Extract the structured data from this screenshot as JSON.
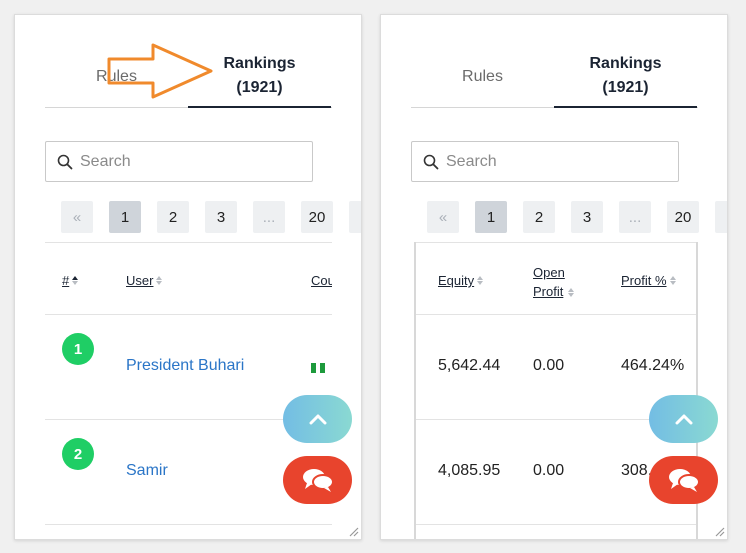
{
  "tabs": {
    "rules": "Rules",
    "rankings_line1": "Rankings",
    "rankings_line2": "(1921)"
  },
  "search": {
    "placeholder": "Search"
  },
  "pagination": {
    "prev": "«",
    "pages": [
      "1",
      "2",
      "3",
      "...",
      "20"
    ],
    "current": "1"
  },
  "table": {
    "columns": {
      "rank": "#",
      "user": "User",
      "country_partial": "Cou",
      "equity": "Equity",
      "open_profit_line1": "Open",
      "open_profit_line2": "Profit",
      "profit_pct": "Profit %"
    },
    "rows": [
      {
        "rank": "1",
        "user": "President Buhari",
        "equity": "5,642.44",
        "open_profit": "0.00",
        "profit_pct": "464.24%"
      },
      {
        "rank": "2",
        "user": "Samir",
        "equity": "4,085.95",
        "open_profit": "0.00",
        "profit_pct": "308."
      }
    ]
  },
  "colors": {
    "brand_dark": "#1b2433",
    "rank_badge": "#1fce65",
    "link": "#2a75c7",
    "chat_button": "#e8442d",
    "annotation_arrow": "#f08a2c"
  },
  "icons": [
    "search-icon",
    "chevron-up-icon",
    "chat-icon",
    "arrow-annotation-icon",
    "resize-grip-icon",
    "flag-icon"
  ]
}
